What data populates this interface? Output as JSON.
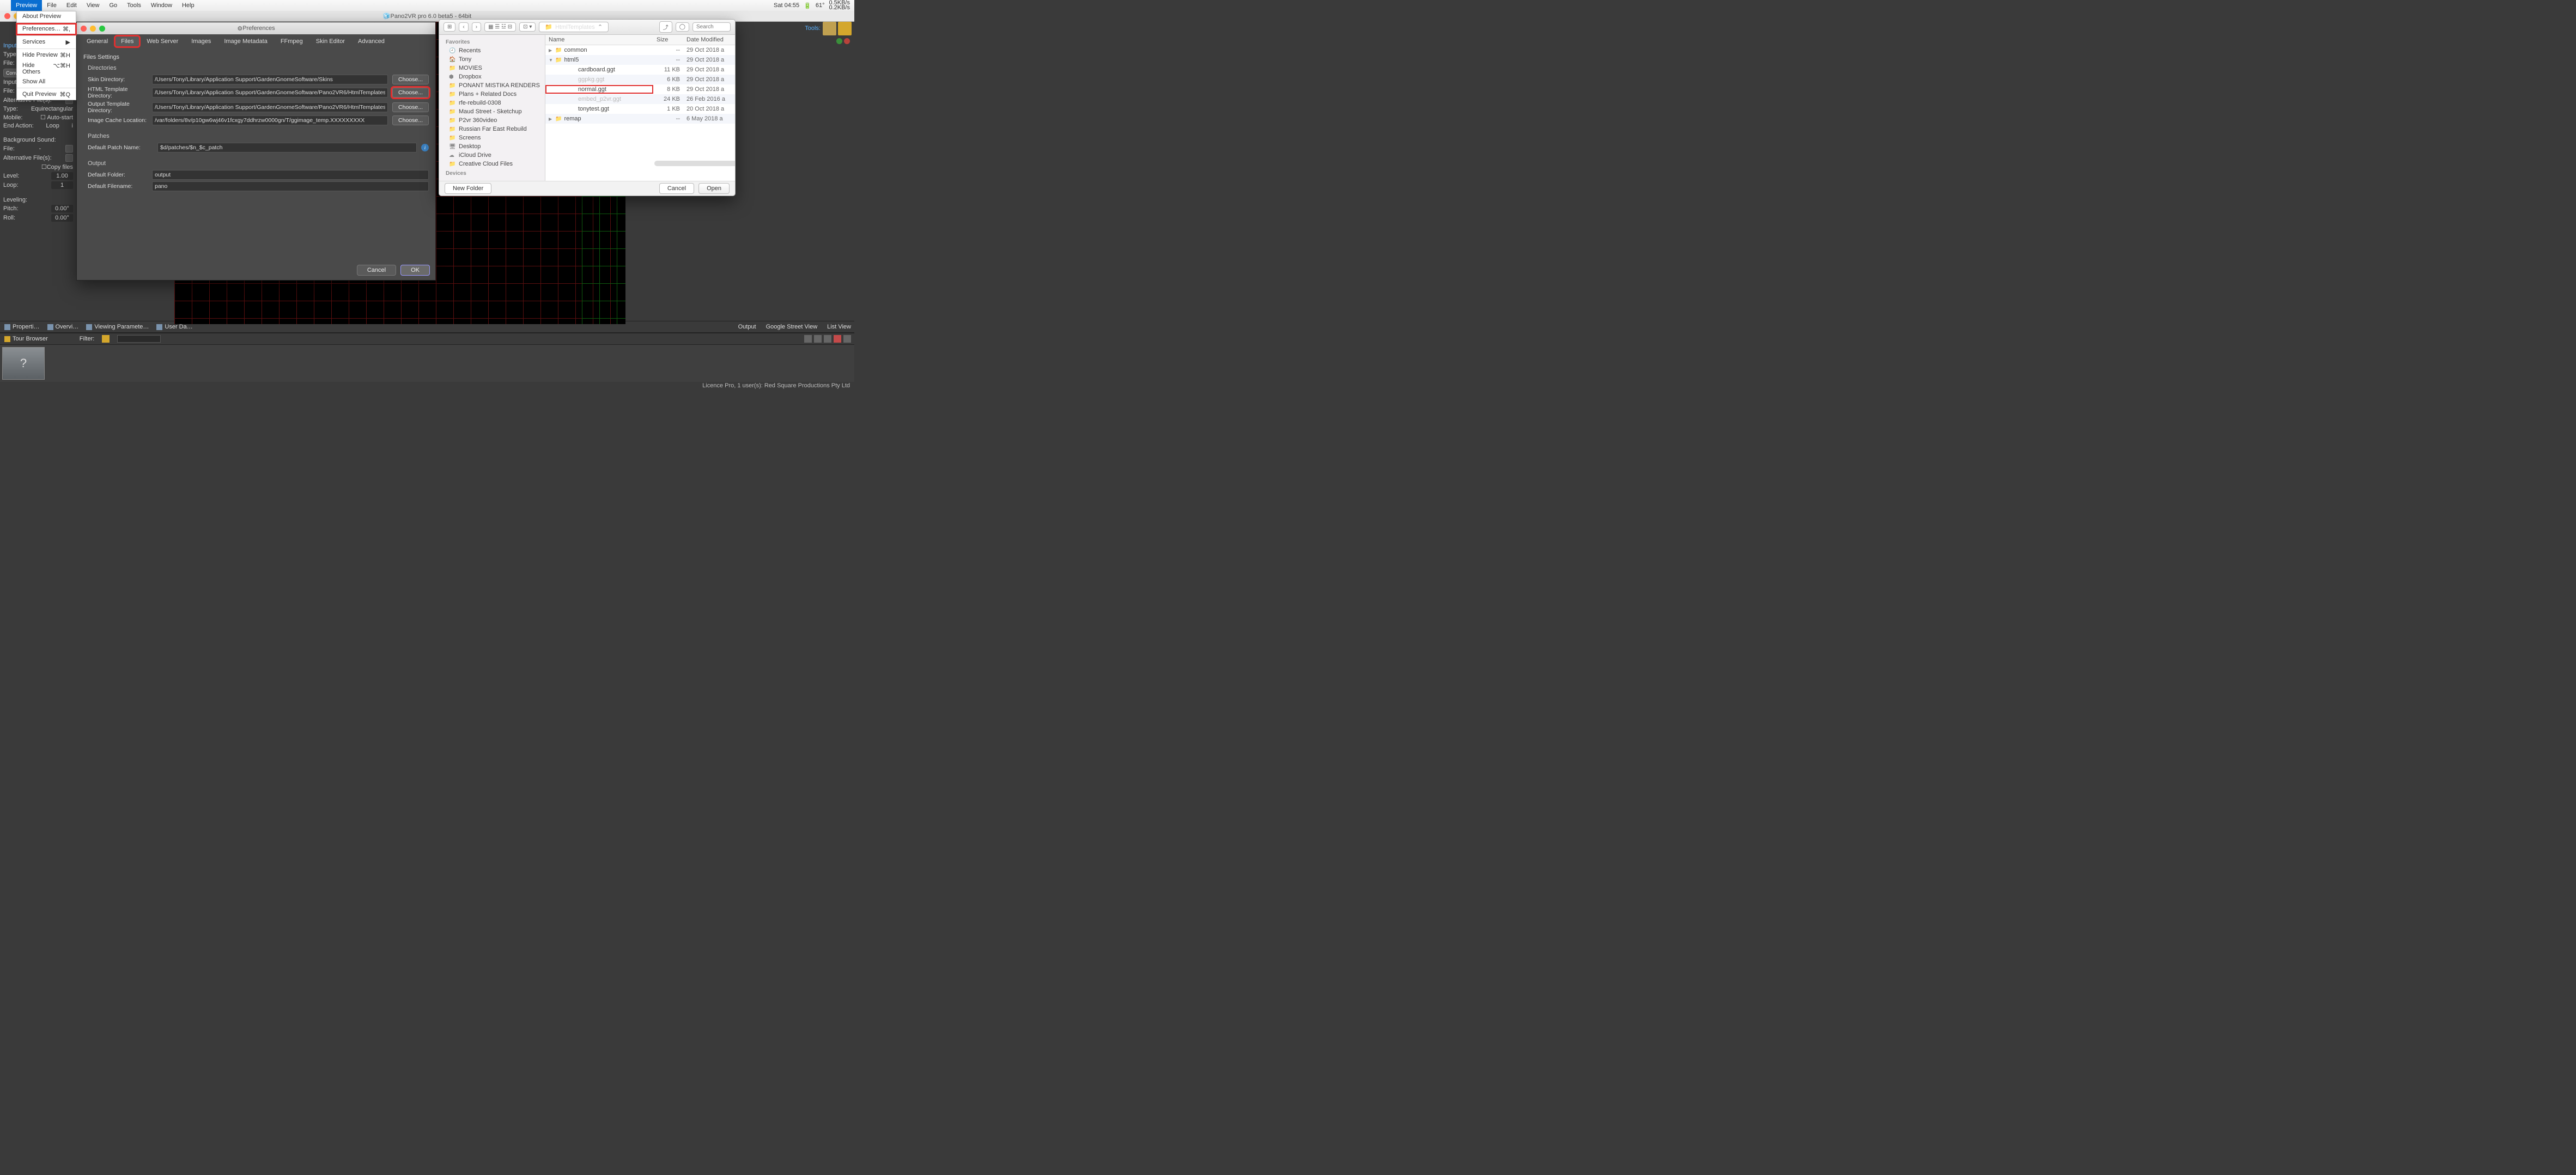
{
  "menubar": {
    "active": "Preview",
    "items": [
      "File",
      "Edit",
      "View",
      "Go",
      "Tools",
      "Window",
      "Help"
    ],
    "right": {
      "time": "Sat 04:55",
      "temp": "61°",
      "net_up": "0.5KB/s",
      "net_down": "0.2KB/s"
    }
  },
  "dropdown": {
    "about": "About Preview",
    "prefs": "Preferences…",
    "prefs_key": "⌘,",
    "services": "Services",
    "services_arrow": "▶",
    "hide_preview": "Hide Preview",
    "hide_preview_key": "⌘H",
    "hide_others": "Hide Others",
    "hide_others_key": "⌥⌘H",
    "show_all": "Show All",
    "quit": "Quit Preview",
    "quit_key": "⌘Q"
  },
  "app": {
    "title": "Pano2VR pro 6.0 beta5 - 64bit",
    "tools": "Tools:"
  },
  "leftpanel": {
    "input_hdr": "Input",
    "type": "Type:",
    "file": "File:",
    "dash": "-",
    "convert": "Convert Input",
    "input_video": "Input Video:",
    "alt_files": "Alternative File(s):",
    "type2": "Type:",
    "equirect": "Equirectangular",
    "mobile": "Mobile:",
    "autostart": "Auto-start",
    "end_action": "End Action:",
    "loop": "Loop",
    "bg_sound": "Background Sound:",
    "copy_files": "Copy files",
    "level": "Level:",
    "level_v": "1.00",
    "loop2": "Loop:",
    "loop_v": "1",
    "leveling": "Leveling:",
    "pitch": "Pitch:",
    "pitch_v": "0.00°",
    "roll": "Roll:",
    "roll_v": "0.00°"
  },
  "prefs": {
    "title": "Preferences",
    "tabs": {
      "general": "General",
      "files": "Files",
      "web": "Web Server",
      "images": "Images",
      "meta": "Image Metadata",
      "ffmpeg": "FFmpeg",
      "skin": "Skin Editor",
      "adv": "Advanced"
    },
    "heading": "Files Settings",
    "dirs": "Directories",
    "labels": {
      "skin": "Skin Directory:",
      "html": "HTML Template Directory:",
      "out": "Output Template Directory:",
      "cache": "Image Cache Location:"
    },
    "values": {
      "skin": "/Users/Tony/Library/Application Support/GardenGnomeSoftware/Skins",
      "html": "/Users/Tony/Library/Application Support/GardenGnomeSoftware/Pano2VR6/HtmlTemplates",
      "out": "/Users/Tony/Library/Application Support/GardenGnomeSoftware/Pano2VR6/HtmlTemplates",
      "cache": "/var/folders/8v/p10gw6wj46v1fcxgy7ddhrzw0000gn/T/ggimage_temp.XXXXXXXXX"
    },
    "choose": "Choose...",
    "patches": "Patches",
    "patch_label": "Default Patch Name:",
    "patch_value": "$d/patches/$n_$c_patch",
    "output": "Output",
    "folder_label": "Default Folder:",
    "folder_value": "output",
    "filename_label": "Default Filename:",
    "filename_value": "pano",
    "cancel": "Cancel",
    "ok": "OK"
  },
  "finder": {
    "path": "HtmlTemplates",
    "search_placeholder": "Search",
    "sidebar_hdr_fav": "Favorites",
    "sidebar_hdr_dev": "Devices",
    "sidebar": [
      "Recents",
      "Tony",
      "MOVIES",
      "Dropbox",
      "PONANT MISTIKA RENDERS",
      "Plans + Related Docs",
      "rfe-rebuild-0308",
      "Maud Street - Sketchup",
      "P2vr 360video",
      "Russian Far East Rebuild",
      "Screens",
      "Desktop",
      "iCloud Drive",
      "Creative Cloud Files"
    ],
    "cols": {
      "name": "Name",
      "size": "Size",
      "date": "Date Modified"
    },
    "rows": [
      {
        "indent": 0,
        "tri": "▶",
        "folder": true,
        "name": "common",
        "size": "--",
        "date": "29 Oct 2018 a"
      },
      {
        "indent": 0,
        "tri": "▼",
        "folder": true,
        "name": "html5",
        "size": "--",
        "date": "29 Oct 2018 a"
      },
      {
        "indent": 2,
        "tri": "",
        "folder": false,
        "name": "cardboard.ggt",
        "size": "11 KB",
        "date": "29 Oct 2018 a"
      },
      {
        "indent": 2,
        "tri": "",
        "folder": false,
        "name": "ggpkg.ggt",
        "size": "6 KB",
        "date": "29 Oct 2018 a",
        "grey": true
      },
      {
        "indent": 2,
        "tri": "",
        "folder": false,
        "name": "normal.ggt",
        "size": "8 KB",
        "date": "29 Oct 2018 a",
        "hl": true
      },
      {
        "indent": 2,
        "tri": "",
        "folder": false,
        "name": "embed_p2vr.ggt",
        "size": "24 KB",
        "date": "26 Feb 2016 a",
        "grey": true
      },
      {
        "indent": 2,
        "tri": "",
        "folder": false,
        "name": "tonytest.ggt",
        "size": "1 KB",
        "date": "20 Oct 2018 a"
      },
      {
        "indent": 0,
        "tri": "▶",
        "folder": true,
        "name": "remap",
        "size": "--",
        "date": "6 May 2018 a"
      }
    ],
    "newfolder": "New Folder",
    "cancel": "Cancel",
    "open": "Open"
  },
  "dock": {
    "props": "Properti…",
    "overview": "Overvi…",
    "viewing": "Viewing Paramete…",
    "userdata": "User Da…",
    "output": "Output",
    "gsv": "Google Street View",
    "listview": "List View",
    "tour": "Tour Browser",
    "filter": "Filter:"
  },
  "status": "Licence Pro, 1 user(s): Red Square Productions Pty Ltd"
}
